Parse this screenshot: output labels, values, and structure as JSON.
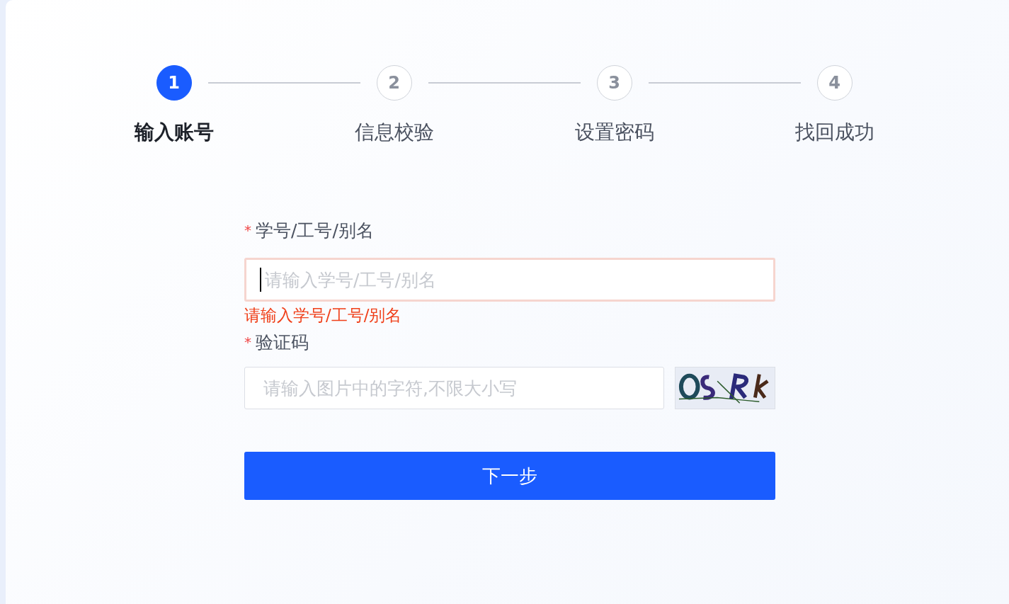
{
  "steps": [
    {
      "number": "1",
      "label": "输入账号",
      "selected": true
    },
    {
      "number": "2",
      "label": "信息校验",
      "selected": false
    },
    {
      "number": "3",
      "label": "设置密码",
      "selected": false
    },
    {
      "number": "4",
      "label": "找回成功",
      "selected": false
    }
  ],
  "fields": [
    {
      "kind": "text",
      "required_mark": "*",
      "label": "学号/工号/别名",
      "placeholder": "请输入学号/工号/别名",
      "focused": true,
      "invalid": true,
      "error": "请输入学号/工号/别名"
    },
    {
      "kind": "captcha",
      "required_mark": "*",
      "label": "验证码",
      "placeholder": "请输入图片中的字符,不限大小写",
      "focused": false,
      "invalid": false
    }
  ],
  "submit_button": "下一步"
}
